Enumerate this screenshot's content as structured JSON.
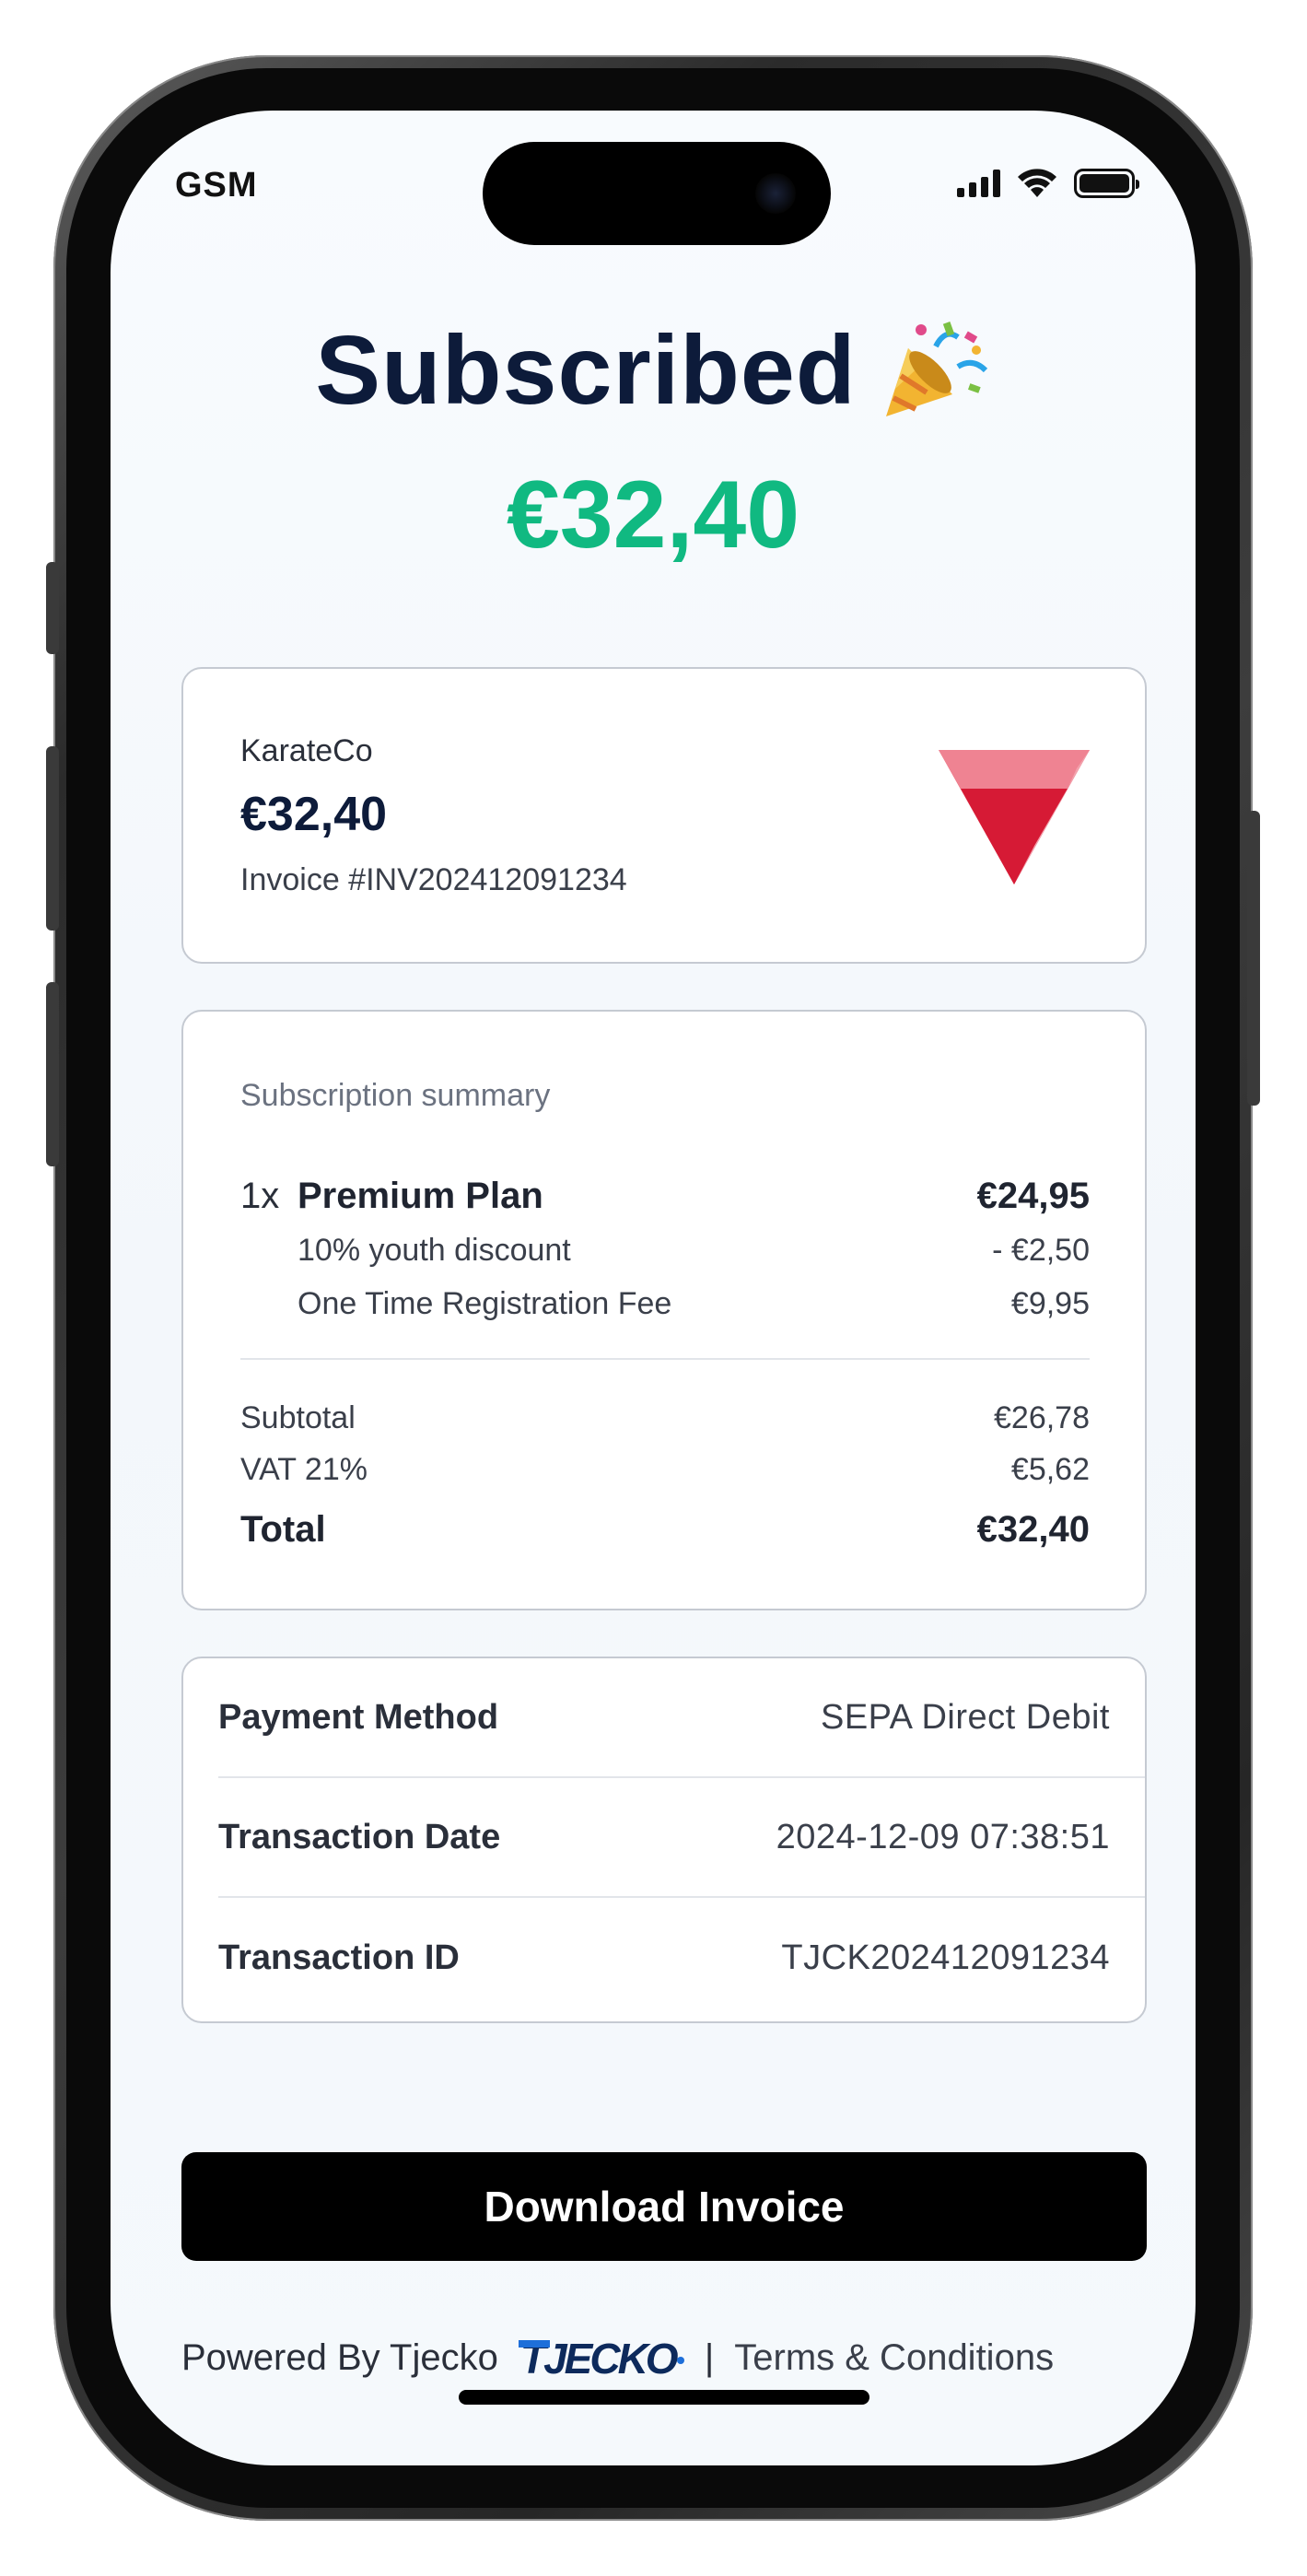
{
  "status_bar": {
    "carrier": "GSM"
  },
  "header": {
    "title": "Subscribed",
    "title_emoji": "🎉",
    "amount": "€32,40"
  },
  "merchant": {
    "name": "KarateCo",
    "amount": "€32,40",
    "invoice": "Invoice #INV202412091234",
    "logo_colors": [
      "#d61a35",
      "#e85a6e",
      "#f3a3ae"
    ]
  },
  "summary": {
    "heading": "Subscription summary",
    "plan": {
      "qty": "1x",
      "name": "Premium Plan",
      "price": "€24,95"
    },
    "lines": [
      {
        "label": "10% youth discount",
        "value": "- €2,50"
      },
      {
        "label": "One Time Registration Fee",
        "value": "€9,95"
      }
    ],
    "subtotal": {
      "label": "Subtotal",
      "value": "€26,78"
    },
    "vat": {
      "label": "VAT 21%",
      "value": "€5,62"
    },
    "total": {
      "label": "Total",
      "value": "€32,40"
    }
  },
  "details": [
    {
      "label": "Payment Method",
      "value": "SEPA Direct Debit"
    },
    {
      "label": "Transaction Date",
      "value": "2024-12-09 07:38:51"
    },
    {
      "label": "Transaction ID",
      "value": "TJCK202412091234"
    }
  ],
  "actions": {
    "download_label": "Download Invoice"
  },
  "footer": {
    "powered_by": "Powered By Tjecko",
    "brand_logo": "TJECKO",
    "separator": "|",
    "terms": "Terms & Conditions"
  },
  "colors": {
    "accent_green": "#10b981",
    "title_navy": "#0d1b3a",
    "brand_blue": "#1e6fd9",
    "button_black": "#000000"
  }
}
